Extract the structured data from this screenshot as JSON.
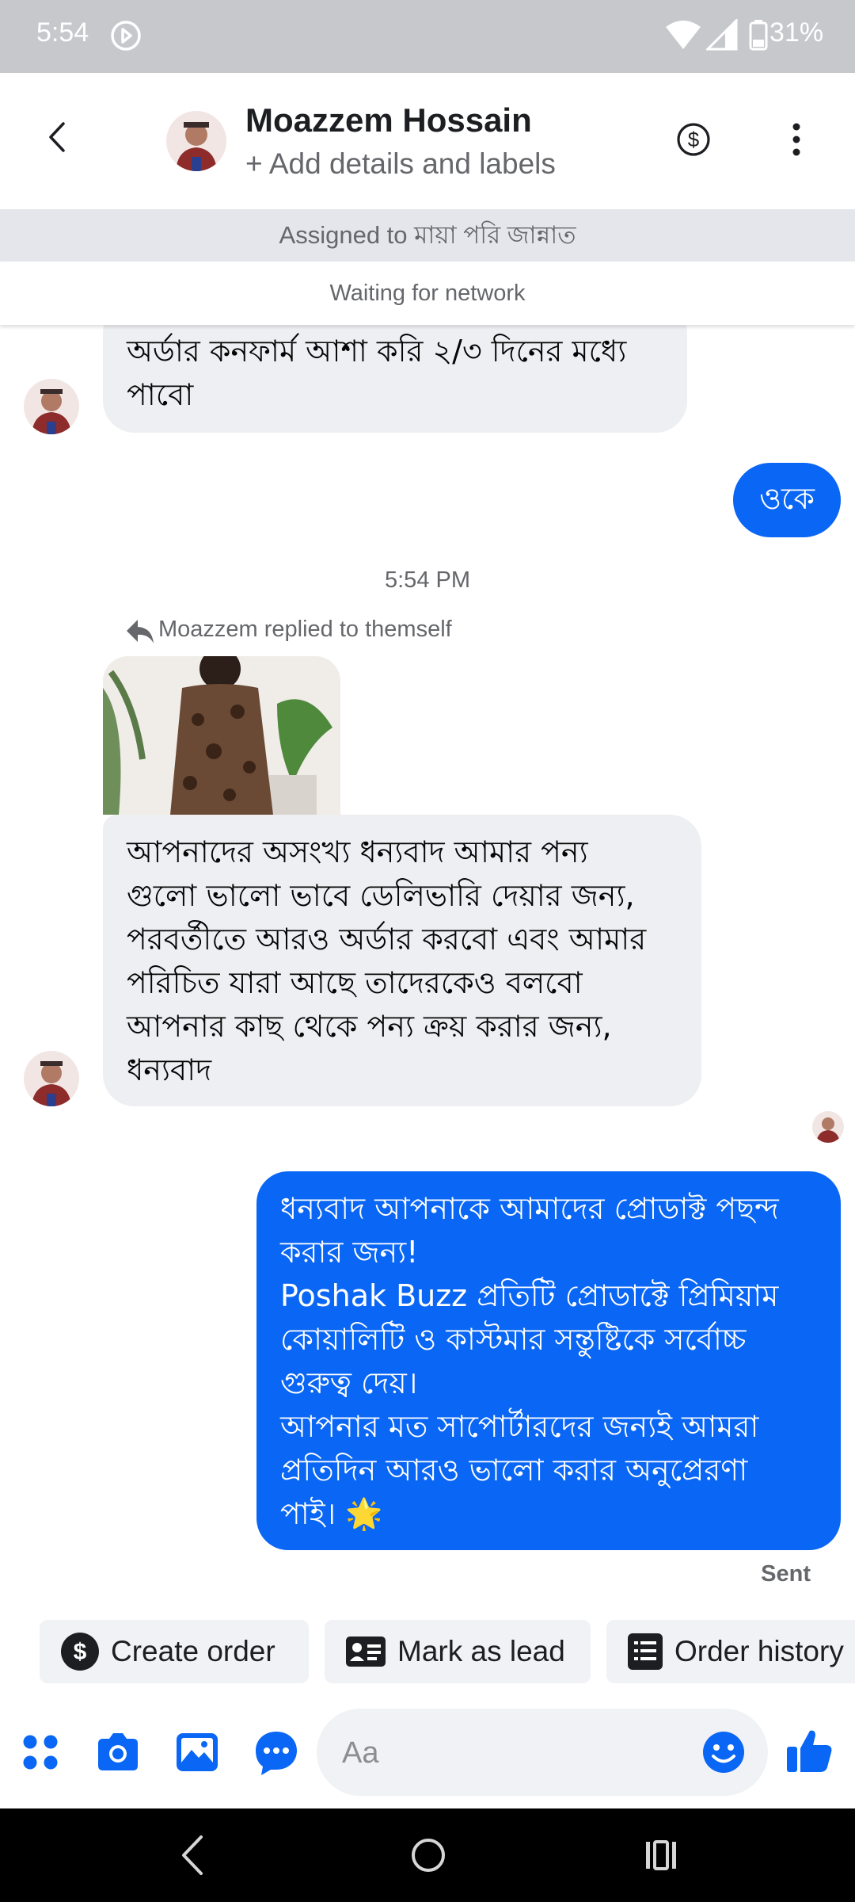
{
  "status_bar": {
    "time": "5:54",
    "battery": "31%"
  },
  "header": {
    "contact_name": "Moazzem Hossain",
    "subtitle": "+ Add details and labels"
  },
  "assigned_banner": "Assigned to মায়া পরি জান্নাত",
  "network_banner": "Waiting for network",
  "messages": [
    {
      "side": "incoming",
      "text": "অর্ডার কনফার্ম আশা করি ২/৩ দিনের মধ্যে\nপাবো"
    },
    {
      "side": "outgoing",
      "text": "ওকে"
    },
    {
      "side": "incoming",
      "text": "আপনাদের অসংখ্য ধন্যবাদ আমার পন্য\nগুলো ভালো ভাবে ডেলিভারি দেয়ার জন্য,\nপরবর্তীতে আরও অর্ডার করবো এবং আমার\nপরিচিত যারা আছে তাদেরকেও বলবো\nআপনার কাছ থেকে পন্য ক্রয় করার জন্য,\nধন্যবাদ"
    },
    {
      "side": "outgoing",
      "text": "ধন্যবাদ আপনাকে আমাদের প্রোডাক্ট পছন্দ\nকরার জন্য!\nPoshak Buzz প্রতিটি প্রোডাক্টে প্রিমিয়াম\nকোয়ালিটি ও কাস্টমার সন্তুষ্টিকে সর্বোচ্চ\nগুরুত্ব দেয়।\nআপনার মত সাপোর্টারদের জন্যই আমরা\nপ্রতিদিন আরও ভালো করার অনুপ্রেরণা\nপাই। 🌟"
    }
  ],
  "timestamp": "5:54 PM",
  "reply_note": "Moazzem replied to themself",
  "delivery_status": "Sent",
  "quick_actions": [
    {
      "label": "Create order",
      "icon": "dollar-circle-icon"
    },
    {
      "label": "Mark as lead",
      "icon": "contact-card-icon"
    },
    {
      "label": "Order history",
      "icon": "list-document-icon"
    }
  ],
  "composer": {
    "placeholder": "Aa"
  },
  "colors": {
    "accent": "#0a66f4",
    "incoming_bubble": "#eeeff2",
    "banner": "#e4e6eb",
    "status_bar": "#c6c8cb"
  }
}
